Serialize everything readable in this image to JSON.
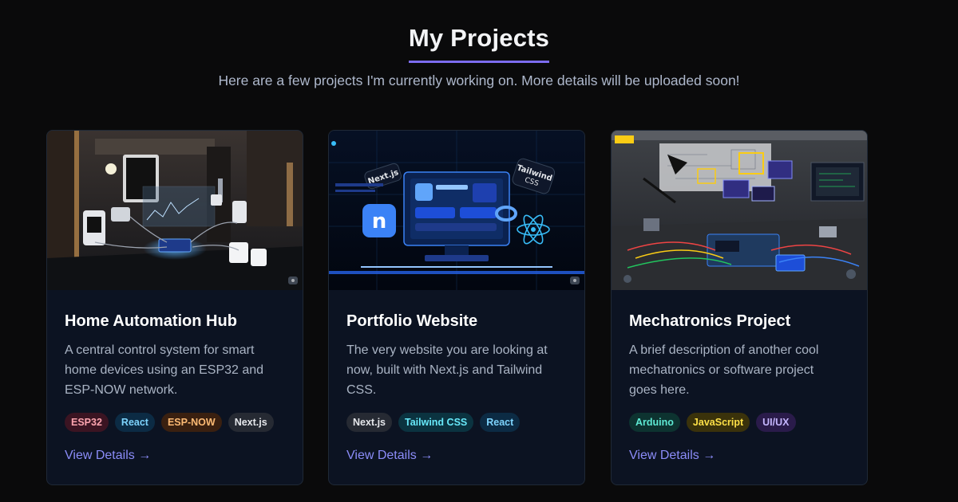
{
  "page": {
    "title": "My Projects",
    "subtitle": "Here are a few projects I'm currently working on. More details will be uploaded soon!"
  },
  "colors": {
    "accent": "#7c6cf0",
    "link": "#8b8cf8",
    "card_bg": "#0c1322"
  },
  "projects": [
    {
      "title": "Home Automation Hub",
      "description": "A central control system for smart home devices using an ESP32 and ESP-NOW network.",
      "tags": [
        {
          "label": "ESP32",
          "color": "#fda4af",
          "bg": "#3b1422"
        },
        {
          "label": "React",
          "color": "#7dd3fc",
          "bg": "#0c2b44"
        },
        {
          "label": "ESP-NOW",
          "color": "#fdba74",
          "bg": "#3a2010"
        },
        {
          "label": "Next.js",
          "color": "#e5e7eb",
          "bg": "#262a33"
        }
      ],
      "link": "View Details →",
      "image_icon": "smart-home-illustration"
    },
    {
      "title": "Portfolio Website",
      "description": "The very website you are looking at now, built with Next.js and Tailwind CSS.",
      "tags": [
        {
          "label": "Next.js",
          "color": "#e5e7eb",
          "bg": "#262a33"
        },
        {
          "label": "Tailwind CSS",
          "color": "#67e8f9",
          "bg": "#0b3340"
        },
        {
          "label": "React",
          "color": "#7dd3fc",
          "bg": "#0c2b44"
        }
      ],
      "link": "View Details →",
      "image_icon": "web-dashboard-illustration",
      "image_labels": {
        "a": "Next.js",
        "b": "Tailwind",
        "c": "CSS"
      }
    },
    {
      "title": "Mechatronics Project",
      "description": "A brief description of another cool mechatronics or software project goes here.",
      "tags": [
        {
          "label": "Arduino",
          "color": "#5eead4",
          "bg": "#0d3330"
        },
        {
          "label": "JavaScript",
          "color": "#fde047",
          "bg": "#3a320b"
        },
        {
          "label": "UI/UX",
          "color": "#c4b5fd",
          "bg": "#2a1b4a"
        }
      ],
      "link": "View Details →",
      "image_icon": "electronics-lab-illustration"
    }
  ]
}
